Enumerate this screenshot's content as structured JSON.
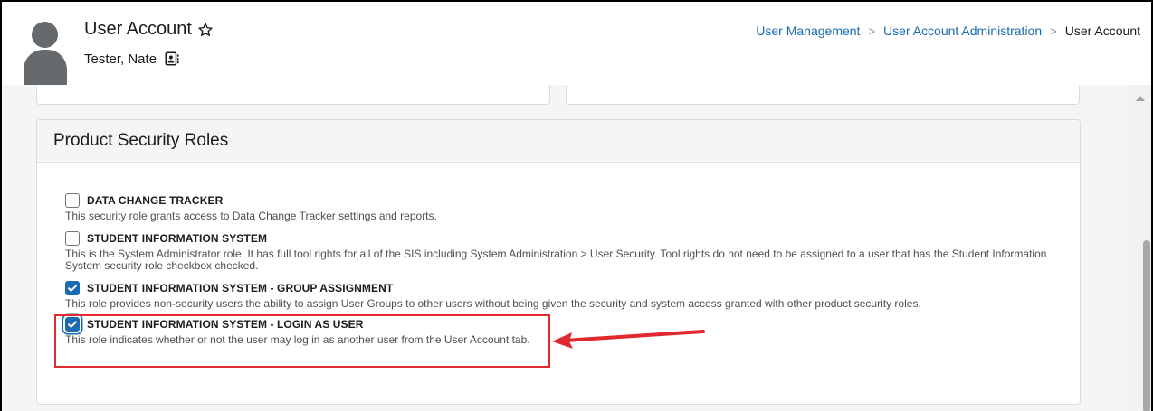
{
  "header": {
    "title": "User Account",
    "person_name": "Tester, Nate",
    "breadcrumb": {
      "items": [
        "User Management",
        "User Account Administration"
      ],
      "current": "User Account"
    }
  },
  "icons": {
    "favorite": "star-outline-icon",
    "contact": "contact-card-icon",
    "avatar": "user-avatar-placeholder"
  },
  "panel": {
    "title": "Product Security Roles",
    "roles": [
      {
        "label": "DATA CHANGE TRACKER",
        "description": "This security role grants access to Data Change Tracker settings and reports.",
        "checked": false
      },
      {
        "label": "STUDENT INFORMATION SYSTEM",
        "description": "This is the System Administrator role. It has full tool rights for all of the SIS including System Administration > User Security. Tool rights do not need to be assigned to a user that has the Student Information System security role checkbox checked.",
        "checked": false
      },
      {
        "label": "STUDENT INFORMATION SYSTEM - GROUP ASSIGNMENT",
        "description": "This role provides non-security users the ability to assign User Groups to other users without being given the security and system access granted with other product security roles.",
        "checked": true
      },
      {
        "label": "STUDENT INFORMATION SYSTEM - LOGIN AS USER",
        "description": "This role indicates whether or not the user may log in as another user from the User Account tab.",
        "checked": true
      }
    ]
  },
  "colors": {
    "accent": "#1a6bb1",
    "annotation": "#e0282e"
  }
}
